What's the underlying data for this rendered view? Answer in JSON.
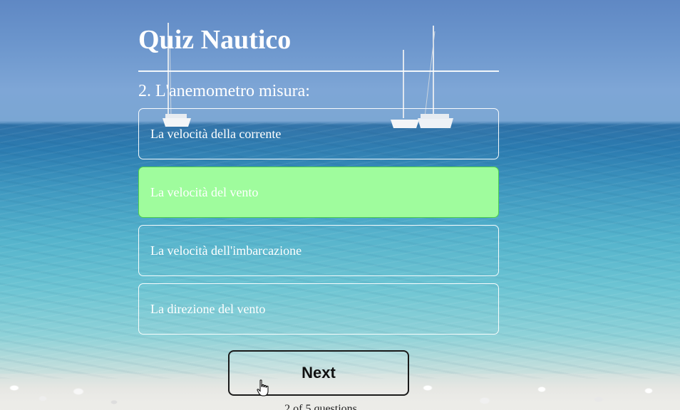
{
  "quiz": {
    "title": "Quiz Nautico",
    "question": "2. L'anemometro misura:",
    "answers": [
      {
        "label": "La velocità della corrente",
        "state": "default"
      },
      {
        "label": "La velocità del vento",
        "state": "correct"
      },
      {
        "label": "La velocità dell'imbarcazione",
        "state": "default"
      },
      {
        "label": "La direzione del vento",
        "state": "default"
      }
    ],
    "next_label": "Next",
    "counter_text": "2 of 5 questions"
  },
  "colors": {
    "correct_fill": "#9ffc9d",
    "correct_border": "#4fcf4c",
    "option_border": "#ffffff",
    "title_text": "#ffffff",
    "button_border": "#1a1a1a"
  },
  "icons": {
    "cursor": "hand-pointer-icon"
  }
}
